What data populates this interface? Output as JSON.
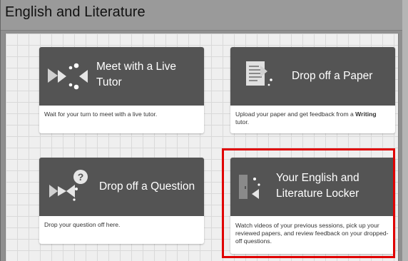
{
  "header": {
    "title": "English and Literature"
  },
  "cards": [
    {
      "title": "Meet with a Live Tutor",
      "description": "Wait for your turn to meet with a live tutor.",
      "icon": "live-tutor-icon"
    },
    {
      "title": "Drop off a Paper",
      "description_pre": "Upload your paper and get feedback from a",
      "description_bold": "Writing",
      "description_post": "tutor.",
      "icon": "paper-icon"
    },
    {
      "title": "Drop off a Question",
      "description": "Drop your question off here.",
      "icon": "question-icon"
    },
    {
      "title_line1": "Your English and",
      "title_line2": "Literature Locker",
      "description": "Watch videos of your previous sessions, pick up your reviewed papers, and review feedback on your dropped-off questions.",
      "icon": "locker-icon"
    }
  ],
  "colors": {
    "card_header": "#545454",
    "highlight": "#e00000",
    "page_bg": "#efefef"
  }
}
